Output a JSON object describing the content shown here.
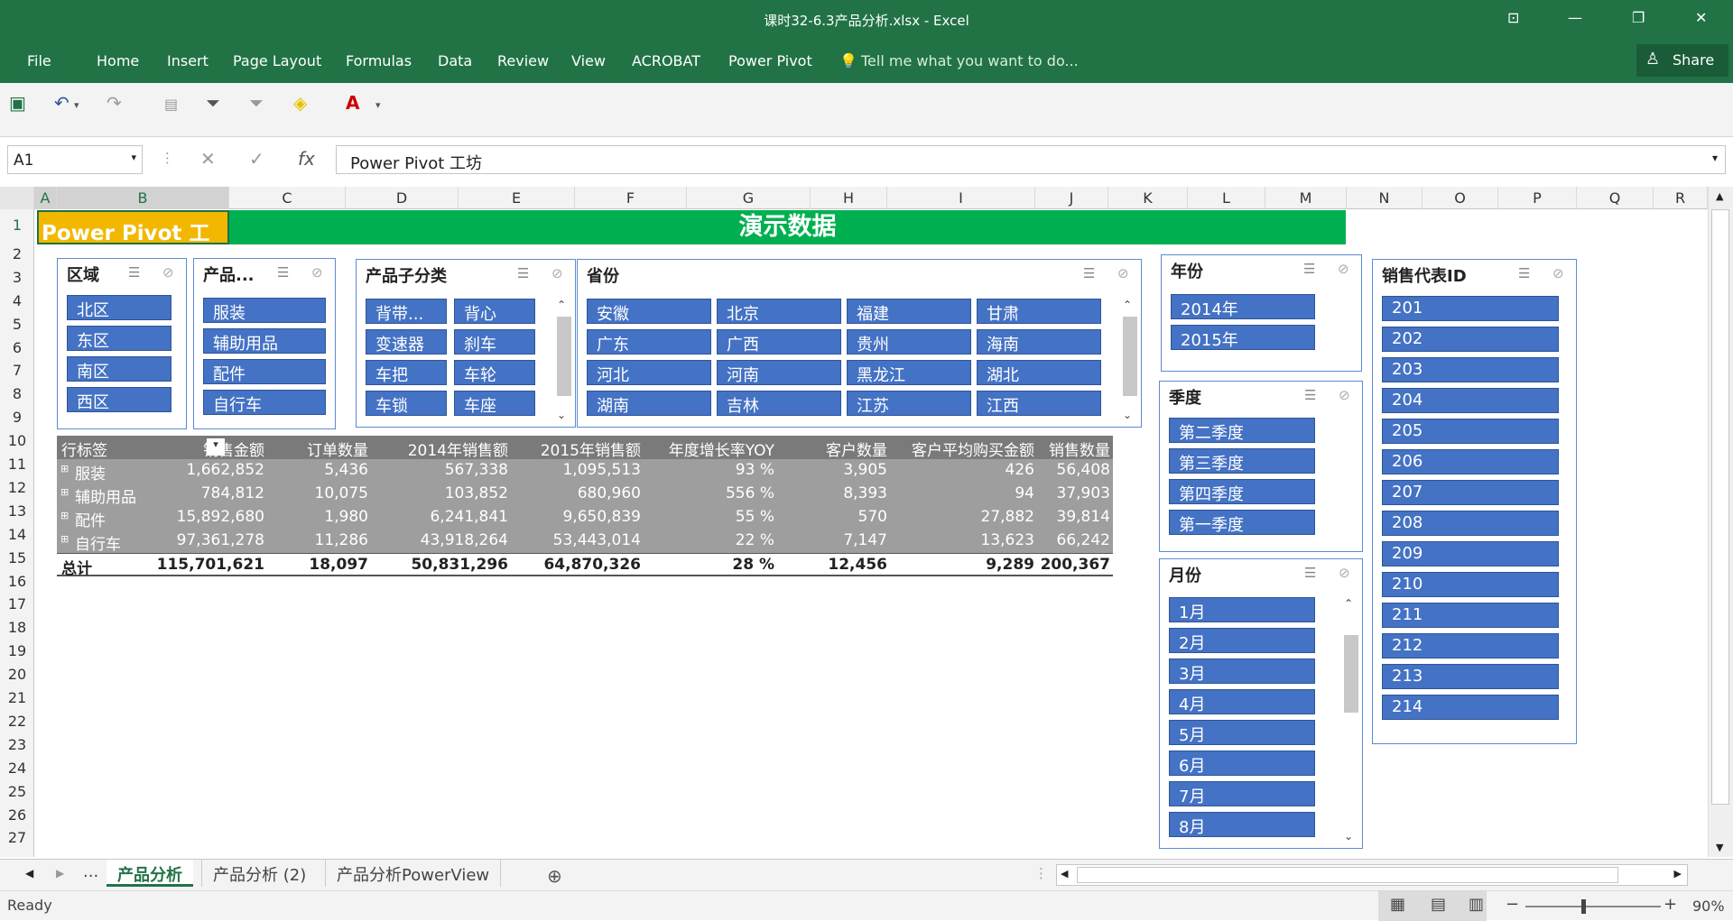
{
  "title": "课时32-6.3产品分析.xlsx - Excel",
  "menu": [
    "File",
    "Home",
    "Insert",
    "Page Layout",
    "Formulas",
    "Data",
    "Review",
    "View",
    "ACROBAT",
    "Power Pivot"
  ],
  "tell_me": "Tell me what you want to do...",
  "share": "Share",
  "namebox": "A1",
  "formula": "Power Pivot 工坊",
  "columns": [
    "A",
    "B",
    "C",
    "D",
    "E",
    "F",
    "G",
    "H",
    "I",
    "J",
    "K",
    "L",
    "M",
    "N",
    "O",
    "P",
    "Q",
    "R"
  ],
  "rows": [
    "1",
    "2",
    "3",
    "4",
    "5",
    "6",
    "7",
    "8",
    "9",
    "10",
    "11",
    "12",
    "13",
    "14",
    "15",
    "16",
    "17",
    "18",
    "19",
    "20",
    "21",
    "22",
    "23",
    "24",
    "25",
    "26",
    "27"
  ],
  "banner": {
    "left": "Power Pivot 工坊",
    "main": "演示数据"
  },
  "slicers": {
    "region": {
      "title": "区域",
      "items": [
        "北区",
        "东区",
        "南区",
        "西区"
      ]
    },
    "product": {
      "title": "产品...",
      "items": [
        "服装",
        "辅助用品",
        "配件",
        "自行车"
      ]
    },
    "subcat": {
      "title": "产品子分类",
      "items": [
        "背带...",
        "背心",
        "变速器",
        "刹车",
        "车把",
        "车轮",
        "车锁",
        "车座"
      ]
    },
    "province": {
      "title": "省份",
      "items": [
        "安徽",
        "北京",
        "福建",
        "甘肃",
        "广东",
        "广西",
        "贵州",
        "海南",
        "河北",
        "河南",
        "黑龙江",
        "湖北",
        "湖南",
        "吉林",
        "江苏",
        "江西"
      ]
    },
    "year": {
      "title": "年份",
      "items": [
        "2014年",
        "2015年"
      ]
    },
    "quarter": {
      "title": "季度",
      "items": [
        "第二季度",
        "第三季度",
        "第四季度",
        "第一季度"
      ]
    },
    "month": {
      "title": "月份",
      "items": [
        "1月",
        "2月",
        "3月",
        "4月",
        "5月",
        "6月",
        "7月",
        "8月"
      ]
    },
    "rep": {
      "title": "销售代表ID",
      "items": [
        "201",
        "202",
        "203",
        "204",
        "205",
        "206",
        "207",
        "208",
        "209",
        "210",
        "211",
        "212",
        "213",
        "214"
      ]
    }
  },
  "pivot": {
    "headers": [
      "行标签",
      "销售金额",
      "订单数量",
      "2014年销售额",
      "2015年销售额",
      "年度增长率YOY",
      "客户数量",
      "客户平均购买金额",
      "销售数量"
    ],
    "rows": [
      [
        "服装",
        "1,662,852",
        "5,436",
        "567,338",
        "1,095,513",
        "93 %",
        "3,905",
        "426",
        "56,408"
      ],
      [
        "辅助用品",
        "784,812",
        "10,075",
        "103,852",
        "680,960",
        "556 %",
        "8,393",
        "94",
        "37,903"
      ],
      [
        "配件",
        "15,892,680",
        "1,980",
        "6,241,841",
        "9,650,839",
        "55 %",
        "570",
        "27,882",
        "39,814"
      ],
      [
        "自行车",
        "97,361,278",
        "11,286",
        "43,918,264",
        "53,443,014",
        "22 %",
        "7,147",
        "13,623",
        "66,242"
      ]
    ],
    "total": [
      "总计",
      "115,701,621",
      "18,097",
      "50,831,296",
      "64,870,326",
      "28 %",
      "12,456",
      "9,289",
      "200,367"
    ]
  },
  "sheets": [
    "...",
    "产品分析",
    "产品分析 (2)",
    "产品分析PowerView"
  ],
  "status": {
    "ready": "Ready",
    "zoom": "90%"
  }
}
